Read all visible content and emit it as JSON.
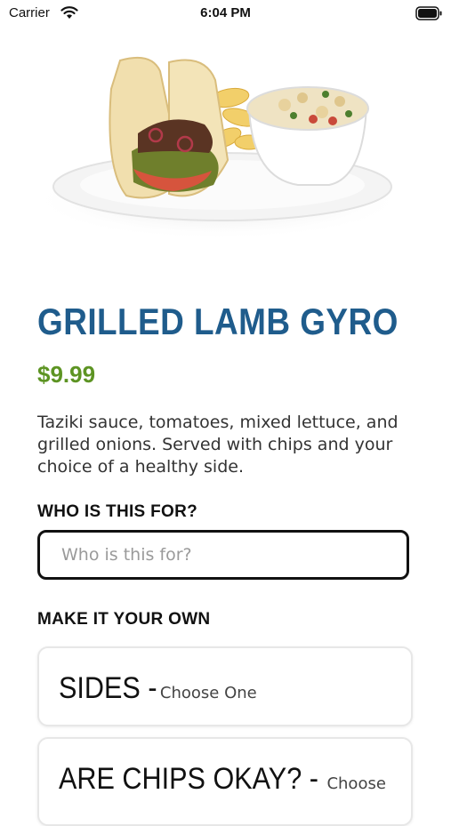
{
  "status_bar": {
    "carrier": "Carrier",
    "time": "6:04 PM"
  },
  "product": {
    "title": "GRILLED LAMB GYRO",
    "price": "$9.99",
    "description": "Taziki sauce, tomatoes, mixed lettuce, and grilled onions.  Served with chips and your choice of a healthy side.",
    "hero_image": "gyro-plate-with-chips-and-pasta-salad"
  },
  "who_section": {
    "label": "WHO IS THIS FOR?",
    "placeholder": "Who is this for?",
    "value": ""
  },
  "customize": {
    "label": "MAKE IT YOUR OWN",
    "options": [
      {
        "heading": "SIDES -",
        "sub": "Choose One"
      },
      {
        "heading": "ARE CHIPS OKAY? -",
        "sub": "Choose"
      }
    ]
  },
  "colors": {
    "title": "#1f5c8c",
    "price": "#5d9423",
    "input_border": "#111111",
    "card_border": "#e7e7e7"
  }
}
